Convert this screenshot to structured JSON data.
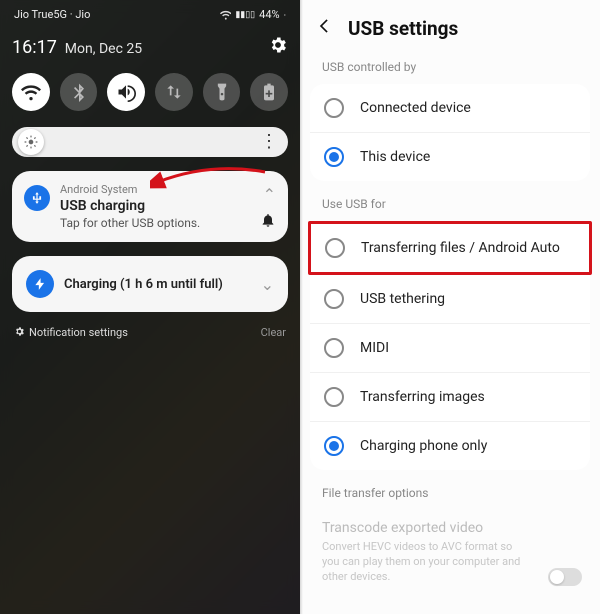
{
  "status": {
    "carrier": "Jio True5G · Jio",
    "battery": "44%"
  },
  "time": "16:17",
  "date": "Mon, Dec 25",
  "notif_usb": {
    "source": "Android System",
    "title": "USB charging",
    "subtitle": "Tap for other USB options."
  },
  "notif_charge": "Charging (1 h 6 m until full)",
  "footer_settings": "Notification settings",
  "footer_clear": "Clear",
  "right_title": "USB settings",
  "section1": "USB controlled by",
  "opts1": {
    "a": "Connected device",
    "b": "This device"
  },
  "section2": "Use USB for",
  "opts2": {
    "a": "Transferring files / Android Auto",
    "b": "USB tethering",
    "c": "MIDI",
    "d": "Transferring images",
    "e": "Charging phone only"
  },
  "section3": "File transfer options",
  "fto_title": "Transcode exported video",
  "fto_desc": "Convert HEVC videos to AVC format so you can play them on your computer and other devices."
}
